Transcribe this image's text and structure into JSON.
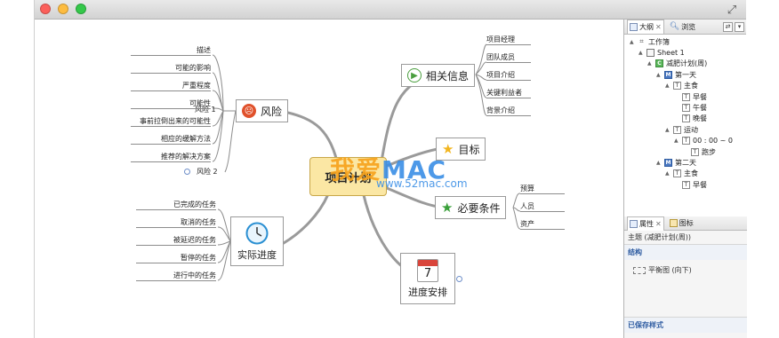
{
  "window": {
    "controls": [
      "close",
      "minimize",
      "maximize"
    ],
    "fullscreen_icon": "fullscreen-arrows-icon"
  },
  "mindmap": {
    "central": "项目计划",
    "watermark": {
      "brand_a": "我爱",
      "brand_b": "MAC",
      "url": "www.52mac.com"
    },
    "topics": {
      "risk": {
        "label": "风险",
        "icon": "risk-face-icon"
      },
      "related": {
        "label": "相关信息",
        "icon": "play-circle-icon"
      },
      "goal": {
        "label": "目标",
        "icon": "star-icon"
      },
      "requirements": {
        "label": "必要条件",
        "icon": "green-star-icon"
      },
      "progress": {
        "label": "实际进度",
        "icon": "clock-icon"
      },
      "schedule": {
        "label": "进度安排",
        "icon": "calendar-icon",
        "day": "7"
      }
    },
    "risk_items": {
      "r1": "风险 1",
      "r2": "风险 2"
    },
    "risk1_children": [
      "描述",
      "可能的影响",
      "严重程度",
      "可能性",
      "事前拉倒出来的可能性",
      "相应的缓解方法",
      "推荐的解决方案"
    ],
    "related_children": [
      "项目经理",
      "团队成员",
      "项目介绍",
      "关键利益者",
      "背景介绍"
    ],
    "requirements_children": [
      "预算",
      "人员",
      "资产"
    ],
    "progress_children": [
      "已完成的任务",
      "取消的任务",
      "被延迟的任务",
      "暂停的任务",
      "进行中的任务"
    ]
  },
  "panel": {
    "tabs": {
      "outline": "大纲",
      "browse": "浏览"
    },
    "outline": [
      {
        "label": "工作簿",
        "icon": "workbook",
        "indent": 0,
        "expanded": true
      },
      {
        "label": "Sheet 1",
        "icon": "sheet",
        "indent": 1,
        "expanded": true
      },
      {
        "label": "减肥计划(周)",
        "icon": "C",
        "indent": 2,
        "expanded": true
      },
      {
        "label": "第一天",
        "icon": "M",
        "indent": 3,
        "expanded": true
      },
      {
        "label": "主食",
        "icon": "T",
        "indent": 4,
        "expanded": true
      },
      {
        "label": "早餐",
        "icon": "T",
        "indent": 5,
        "expanded": null
      },
      {
        "label": "午餐",
        "icon": "T",
        "indent": 5,
        "expanded": null
      },
      {
        "label": "晚餐",
        "icon": "T",
        "indent": 5,
        "expanded": null
      },
      {
        "label": "运动",
        "icon": "T",
        "indent": 4,
        "expanded": true
      },
      {
        "label": "00 : 00 ~ 0",
        "icon": "T",
        "indent": 5,
        "expanded": true
      },
      {
        "label": "跑步",
        "icon": "T",
        "indent": 6,
        "expanded": null
      },
      {
        "label": "第二天",
        "icon": "M",
        "indent": 3,
        "expanded": true
      },
      {
        "label": "主食",
        "icon": "T",
        "indent": 4,
        "expanded": true
      },
      {
        "label": "早餐",
        "icon": "T",
        "indent": 5,
        "expanded": null
      }
    ],
    "props_tabs": {
      "properties": "属性",
      "icons": "图标"
    },
    "props_subject": "主题 (减肥计划(周))",
    "section_structure": "结构",
    "structure_value": "平衡图 (向下)",
    "section_saved": "已保存样式"
  },
  "colors": {
    "central_fill": "#fbe7a4",
    "accent_blue": "#2c5aa0",
    "watermark_orange": "#f7a21a",
    "watermark_blue": "#3a8ee6"
  }
}
